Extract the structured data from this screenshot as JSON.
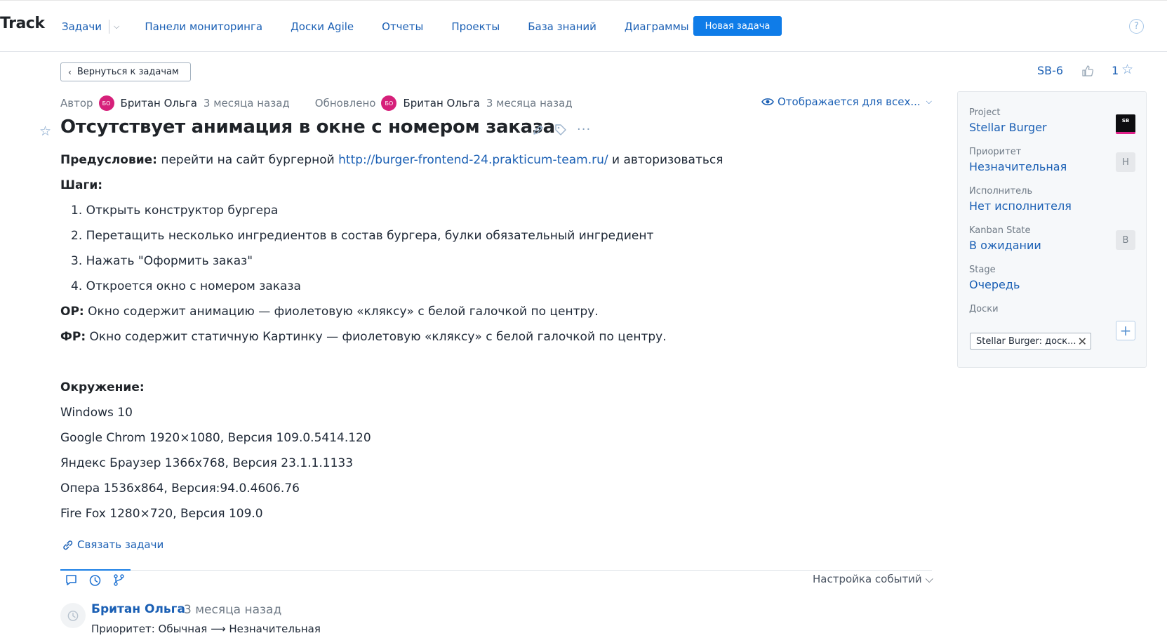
{
  "app": {
    "logo": "Track"
  },
  "nav": {
    "tasks": "Задачи",
    "items": [
      "Панели мониторинга",
      "Доски Agile",
      "Отчеты",
      "Проекты",
      "База знаний",
      "Диаграммы Ганта"
    ],
    "new_task": "Новая задача",
    "help": "?"
  },
  "toolbar": {
    "back_label": "Вернуться к задачам",
    "issue_id": "SB-6",
    "votes": "1"
  },
  "meta": {
    "author_label": "Автор",
    "author_initials": "БО",
    "author_name": "Британ Ольга",
    "author_time": "3 месяца назад",
    "updated_label": "Обновлено",
    "updater_initials": "БО",
    "updater_name": "Британ Ольга",
    "updated_time": "3 месяца назад",
    "visibility": "Отображается для всех..."
  },
  "issue": {
    "title": "Отсутствует анимация в окне с номером заказа",
    "precondition_label": "Предусловие:",
    "precondition_text": " перейти на сайт бургерной ",
    "precondition_link": "http://burger-frontend-24.prakticum-team.ru/",
    "precondition_tail": " и авторизоваться",
    "steps_label": "Шаги:",
    "steps": [
      "1. Открыть конструктор бургера",
      "2. Перетащить несколько ингредиентов в состав бургера, булки обязательный ингредиент",
      "3. Нажать \"Оформить заказ\"",
      "4. Откроется окно с номером заказа"
    ],
    "expected_label": "ОР:",
    "expected_text": " Окно содержит анимацию — фиолетовую «кляксу» с белой галочкой по центру.",
    "actual_label": "ФР:",
    "actual_text": " Окно содержит статичную Картинку — фиолетовую «кляксу» с белой галочкой по центру.",
    "env_label": "Окружение:",
    "environment": [
      "Windows 10",
      "Google Chrom 1920×1080, Версия 109.0.5414.120",
      "Яндекс Браузер 1366x768, Версия 23.1.1.1133",
      "Опера 1536x864, Версия:94.0.4606.76",
      "Fire Fox 1280×720, Версия 109.0"
    ],
    "link_tasks": "Связать задачи"
  },
  "activity": {
    "settings": "Настройка событий",
    "author": "Британ Ольга",
    "time": "3 месяца назад",
    "change": "Приоритет: Обычная ⟶ Незначительная"
  },
  "side": {
    "project_label": "Project",
    "project_value": "Stellar Burger",
    "project_logo": "SB",
    "priority_label": "Приоритет",
    "priority_value": "Незначительная",
    "priority_badge": "Н",
    "assignee_label": "Исполнитель",
    "assignee_value": "Нет исполнителя",
    "kanban_label": "Kanban State",
    "kanban_value": "В ожидании",
    "kanban_badge": "В",
    "stage_label": "Stage",
    "stage_value": "Очередь",
    "boards_label": "Доски",
    "board_tag": "Stellar Burger: доск..."
  },
  "colors": {
    "accent": "#0f7ce8",
    "link": "#1a5fb4",
    "avatar": "#d6207a"
  },
  "icons": [
    "chevron-left-icon",
    "chevron-down-icon",
    "help-icon",
    "thumbs-up-icon",
    "star-icon",
    "eye-icon",
    "pencil-icon",
    "tag-icon",
    "more-icon",
    "link-icon",
    "comment-icon",
    "history-icon",
    "branch-icon",
    "close-icon",
    "plus-icon"
  ]
}
